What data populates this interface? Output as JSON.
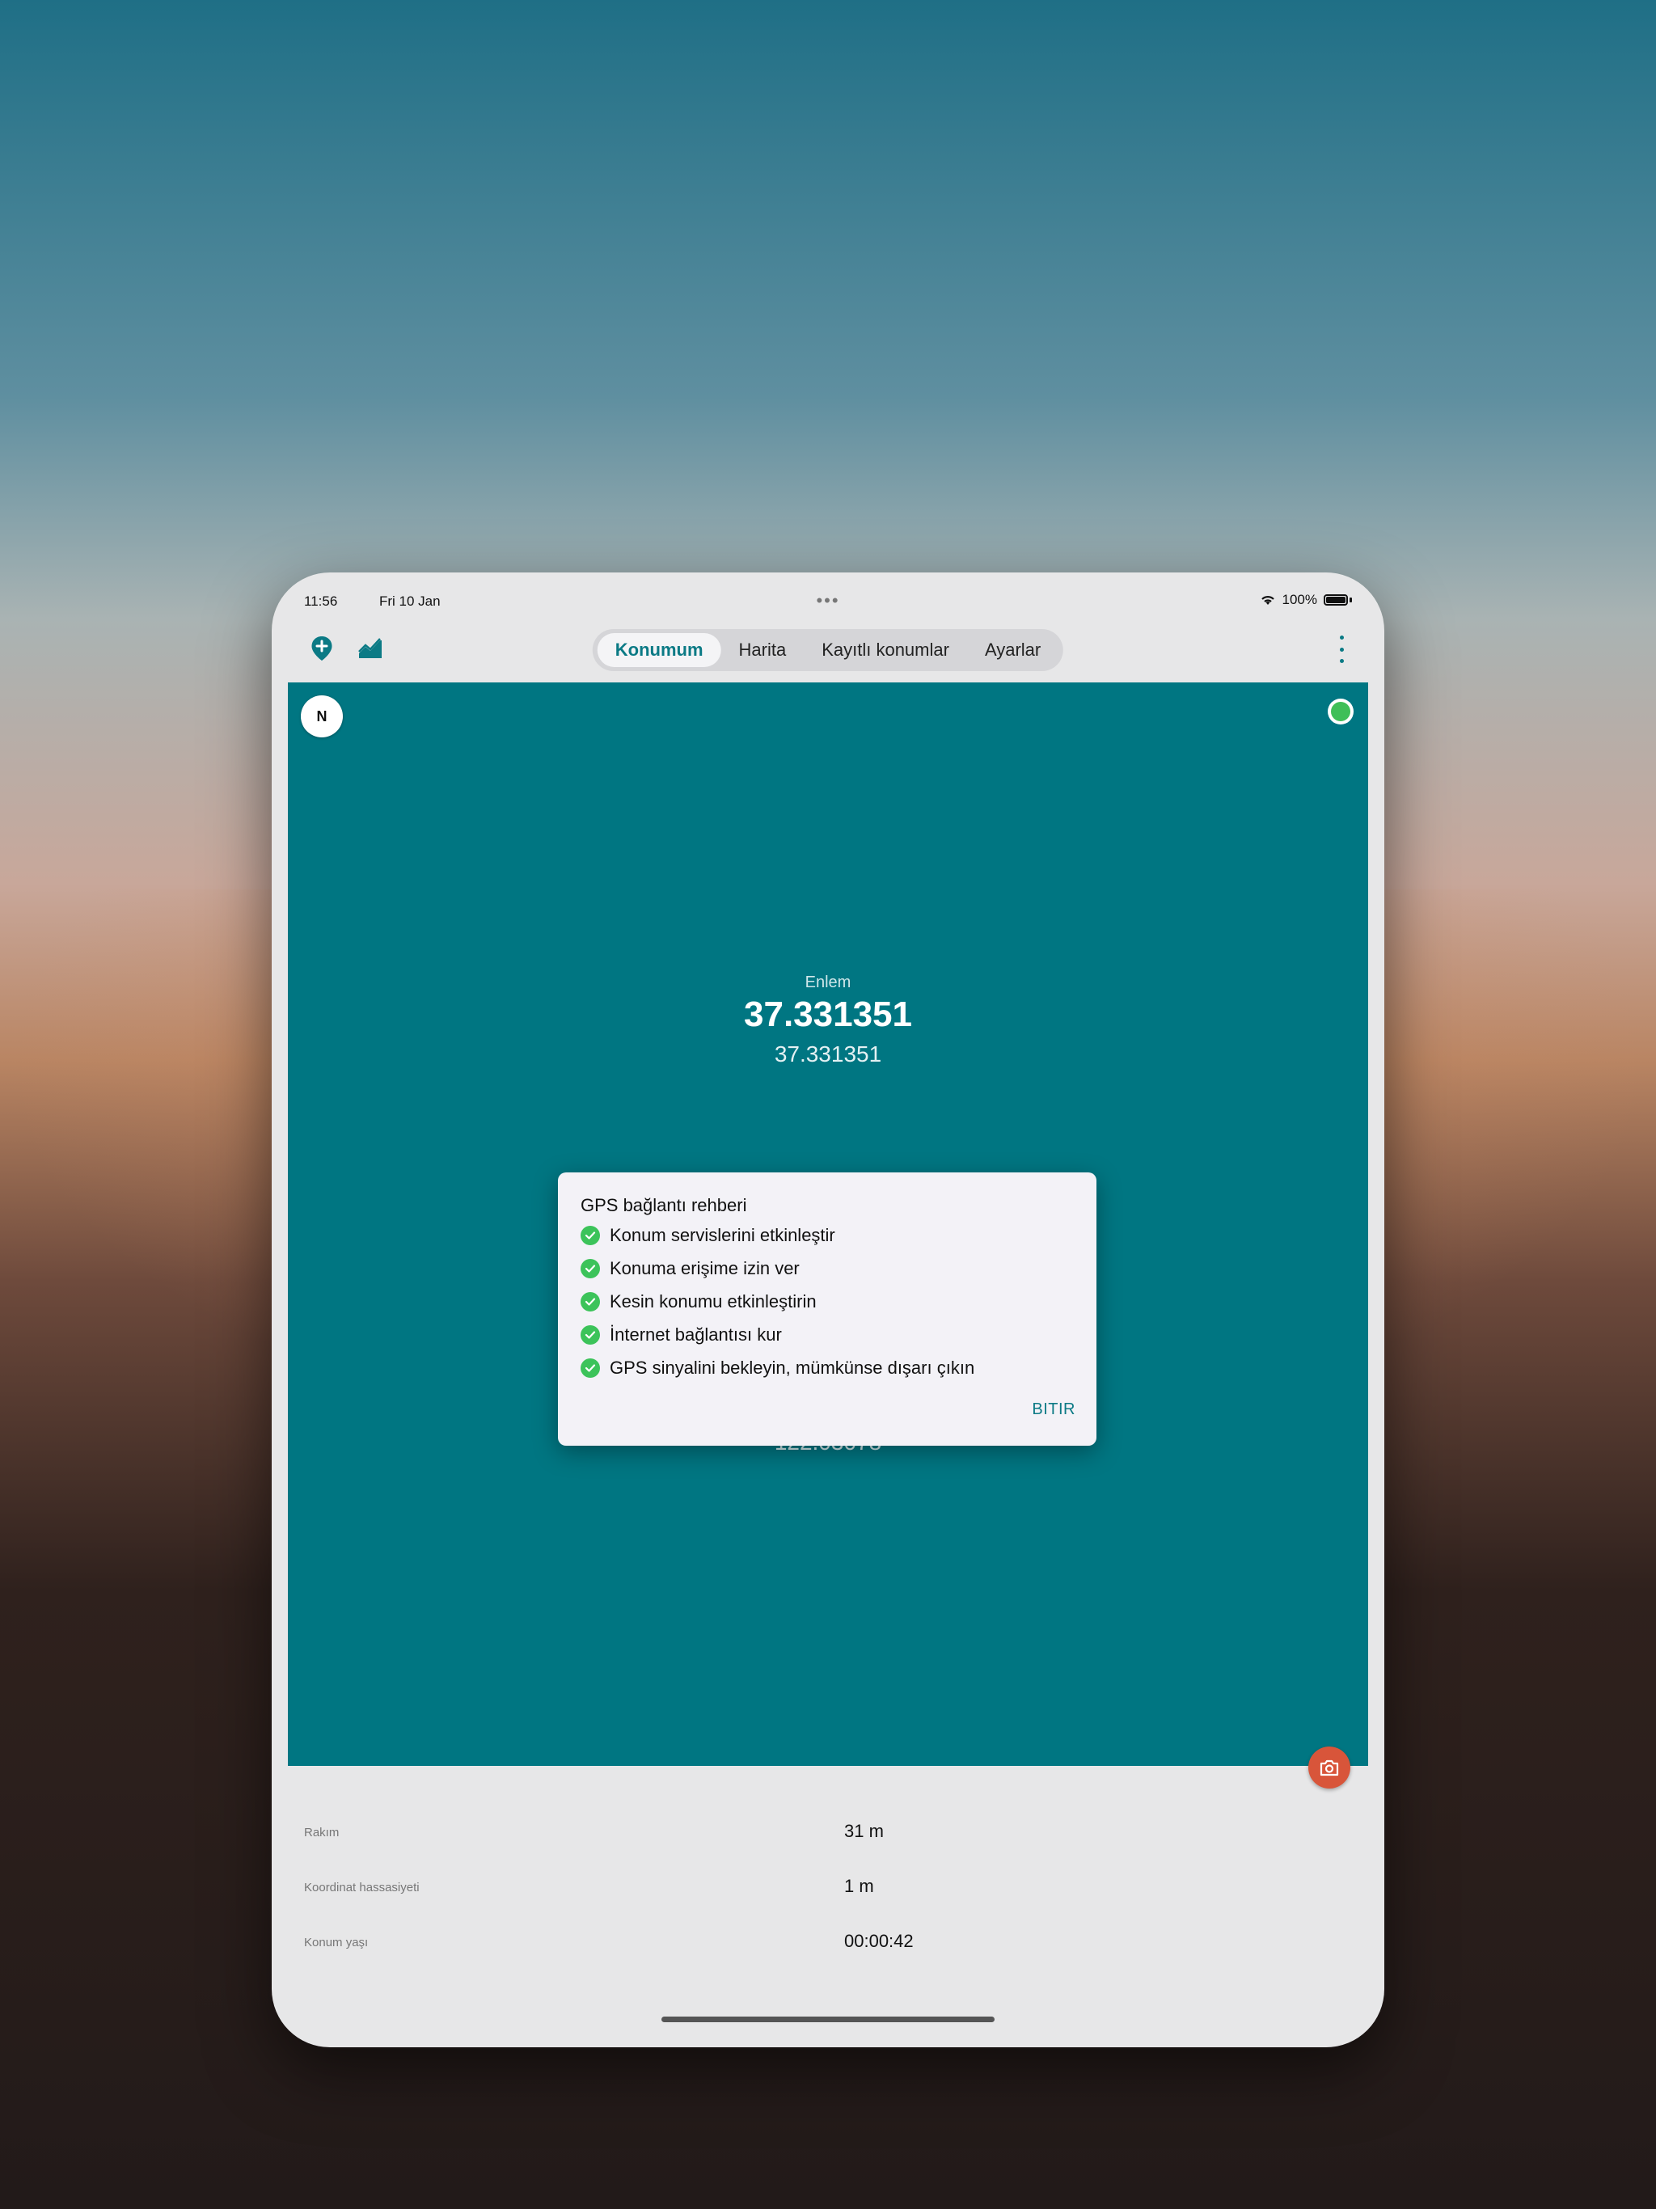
{
  "status": {
    "time": "11:56",
    "date": "Fri 10 Jan",
    "battery": "100%"
  },
  "tabs": [
    "Konumum",
    "Harita",
    "Kayıtlı konumlar",
    "Ayarlar"
  ],
  "active_tab": "Konumum",
  "compass": {
    "letter": "N"
  },
  "latitude": {
    "label": "Enlem",
    "value": "37.331351",
    "value_alt": "37.331351"
  },
  "longitude": {
    "value_alt_partial": "122.03078"
  },
  "info": [
    {
      "label": "Rakım",
      "value": "31 m"
    },
    {
      "label": "Koordinat hassasiyeti",
      "value": "1 m"
    },
    {
      "label": "Konum yaşı",
      "value": "00:00:42"
    }
  ],
  "dialog": {
    "title": "GPS bağlantı rehberi",
    "items": [
      "Konum servislerini etkinleştir",
      "Konuma erişime izin ver",
      "Kesin konumu etkinleştirin",
      "İnternet bağlantısı kur",
      "GPS sinyalini bekleyin, mümkünse dışarı çıkın"
    ],
    "button": "BITIR"
  },
  "colors": {
    "accent": "#007682",
    "check": "#3cc35a",
    "camera": "#d8553a"
  }
}
